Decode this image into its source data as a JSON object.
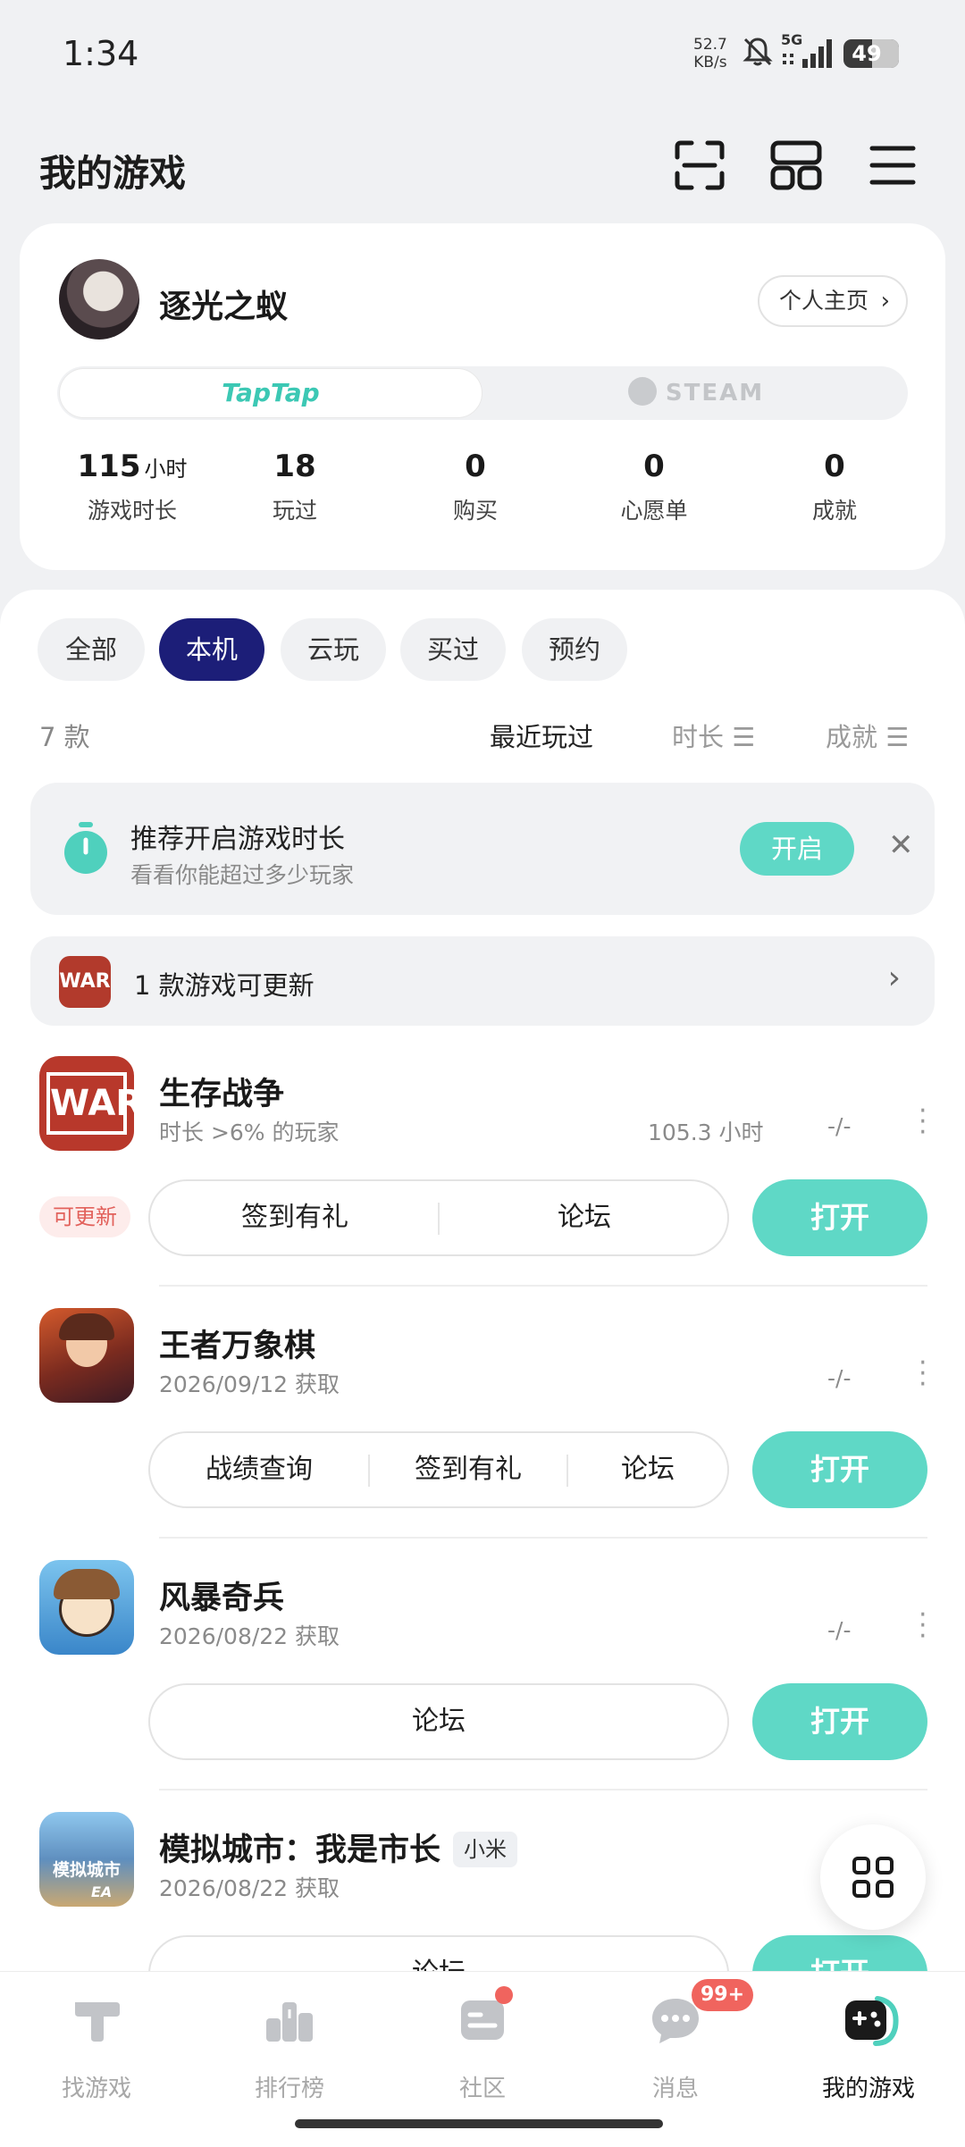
{
  "status_bar": {
    "time": "1:34",
    "net_speed": "52.7",
    "net_unit": "KB/s",
    "network": "5G",
    "battery": "49"
  },
  "header": {
    "title": "我的游戏"
  },
  "profile": {
    "username": "逐光之蚁",
    "homepage_label": "个人主页",
    "platforms": {
      "taptap": "TapTap",
      "steam": "STEAM",
      "selected": "taptap"
    },
    "stats": [
      {
        "value": "115",
        "unit": "小时",
        "label": "游戏时长"
      },
      {
        "value": "18",
        "label": "玩过"
      },
      {
        "value": "0",
        "label": "购买"
      },
      {
        "value": "0",
        "label": "心愿单"
      },
      {
        "value": "0",
        "label": "成就"
      }
    ]
  },
  "filters": {
    "tabs": [
      "全部",
      "本机",
      "云玩",
      "买过",
      "预约"
    ],
    "active": "本机"
  },
  "list": {
    "count": "7 款",
    "sort": {
      "recent": "最近玩过",
      "duration": "时长",
      "achievement": "成就"
    }
  },
  "tip": {
    "title": "推荐开启游戏时长",
    "subtitle": "看看你能超过多少玩家",
    "enable_label": "开启"
  },
  "update_bar": {
    "text": "1 款游戏可更新",
    "thumb_text": "WAR"
  },
  "games": [
    {
      "name": "生存战争",
      "sub": "时长 >6% 的玩家",
      "hours": "105.3 小时",
      "score": "-/-",
      "update_tag": "可更新",
      "icon_text": "WAR",
      "actions": [
        "签到有礼",
        "论坛"
      ],
      "open_label": "打开"
    },
    {
      "name": "王者万象棋",
      "sub": "2026/09/12 获取",
      "score": "-/-",
      "actions": [
        "战绩查询",
        "签到有礼",
        "论坛"
      ],
      "open_label": "打开"
    },
    {
      "name": "风暴奇兵",
      "sub": "2026/08/22 获取",
      "score": "-/-",
      "actions": [
        "论坛"
      ],
      "open_label": "打开"
    },
    {
      "name": "模拟城市：我是市长",
      "platform_tag": "小米",
      "sub": "2026/08/22 获取",
      "icon_text": "模拟城市",
      "icon_sub": "EA",
      "actions": [
        "论坛"
      ],
      "open_label": "打开"
    }
  ],
  "bottom_nav": [
    {
      "label": "找游戏",
      "icon": "find-games-icon"
    },
    {
      "label": "排行榜",
      "icon": "leaderboard-icon"
    },
    {
      "label": "社区",
      "icon": "community-icon"
    },
    {
      "label": "消息",
      "icon": "messages-icon",
      "badge": "99+"
    },
    {
      "label": "我的游戏",
      "icon": "my-games-icon",
      "active": true
    }
  ],
  "colors": {
    "accent": "#5fd8c6",
    "active_tab": "#1c1e78",
    "badge": "#f0645e",
    "update_tag_text": "#e2625c"
  }
}
